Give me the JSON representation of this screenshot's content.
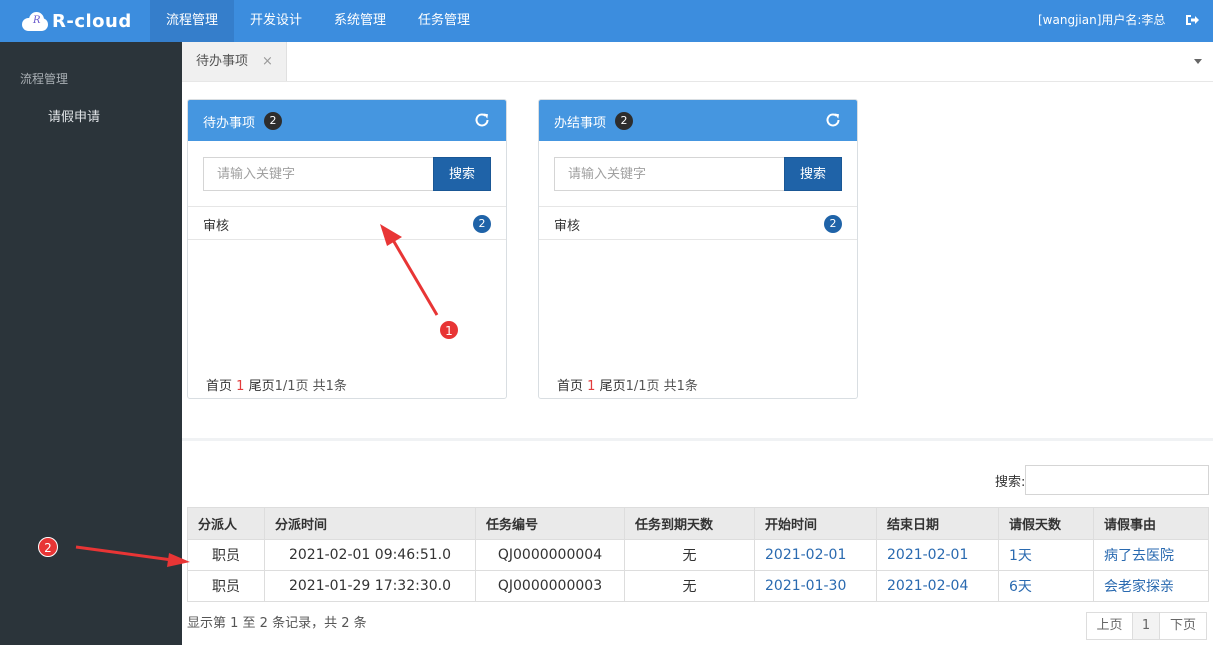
{
  "app": {
    "logo_text": "R-cloud",
    "logo_mark": "R"
  },
  "topnav": [
    {
      "label": "流程管理"
    },
    {
      "label": "开发设计"
    },
    {
      "label": "系统管理"
    },
    {
      "label": "任务管理"
    }
  ],
  "user": {
    "label": "[wangjian]用户名:李总",
    "logout_icon": "logout-icon"
  },
  "sidebar": {
    "section": "流程管理",
    "item": "请假申请"
  },
  "tabs": {
    "active": "待办事项",
    "close": "×"
  },
  "panel_todo": {
    "title": "待办事项",
    "badge": "2",
    "search_placeholder": "请输入关键字",
    "search_btn": "搜索",
    "row_label": "审核",
    "row_count": "2",
    "pager_first": "首页",
    "pager_cur": "1",
    "pager_last": "尾页",
    "pager_info": "1/1页 共1条"
  },
  "panel_done": {
    "title": "办结事项",
    "badge": "2",
    "search_placeholder": "请输入关键字",
    "search_btn": "搜索",
    "row_label": "审核",
    "row_count": "2",
    "pager_first": "首页",
    "pager_cur": "1",
    "pager_last": "尾页",
    "pager_info": "1/1页 共1条"
  },
  "table": {
    "search_label": "搜索:",
    "headers": [
      "分派人",
      "分派时间",
      "任务编号",
      "任务到期天数",
      "开始时间",
      "结束日期",
      "请假天数",
      "请假事由"
    ],
    "rows": [
      [
        "职员",
        "2021-02-01 09:46:51.0",
        "QJ0000000004",
        "无",
        "2021-02-01",
        "2021-02-01",
        "1天",
        "病了去医院"
      ],
      [
        "职员",
        "2021-01-29 17:32:30.0",
        "QJ0000000003",
        "无",
        "2021-01-30",
        "2021-02-04",
        "6天",
        "会老家探亲"
      ]
    ],
    "footer": "显示第 1 至 2 条记录，共 2 条",
    "prev": "上页",
    "page": "1",
    "next": "下页"
  },
  "annotations": {
    "a1": "1",
    "a2": "2"
  },
  "colors": {
    "topbar": "#3c8dde",
    "sidebar": "#2b343a",
    "panel_header": "#4596e0",
    "button": "#1f63a8",
    "annotation": "#e83535"
  }
}
